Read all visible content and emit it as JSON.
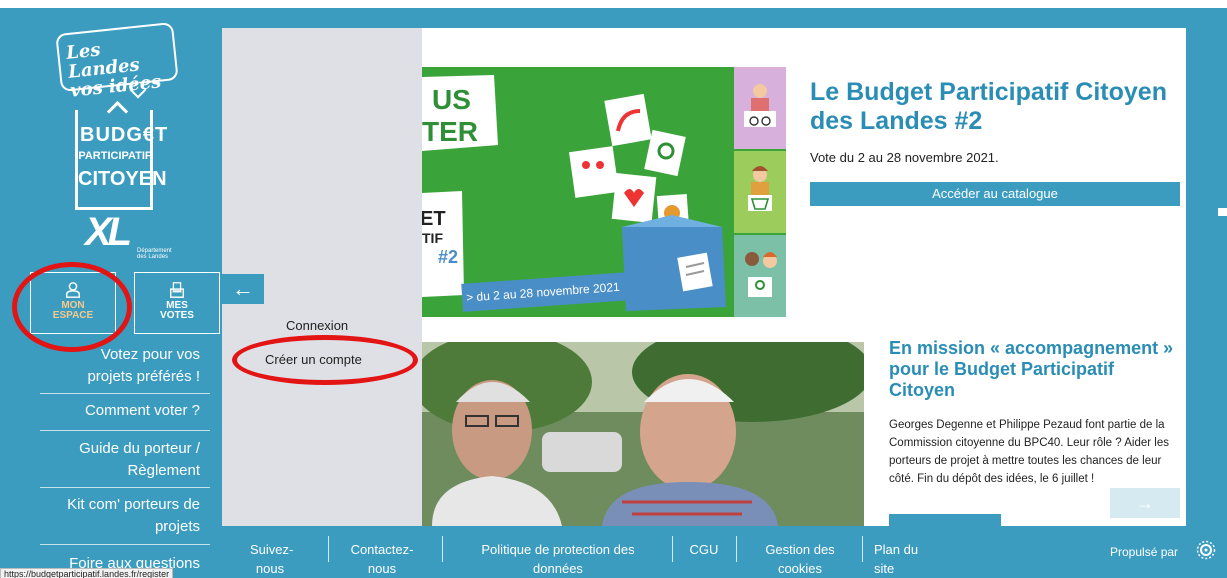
{
  "logo": {
    "line1": "Les Landes",
    "line2": "vos idées",
    "budget1": "BUDG€T",
    "budget2": "PARTICIPATIF",
    "budget3": "CITOYEN",
    "xl": "XL",
    "dept1": "Département",
    "dept2": "des Landes"
  },
  "account_buttons": {
    "espace_line1": "MON",
    "espace_line2": "ESPACE",
    "votes_line1": "MES",
    "votes_line2": "VOTES"
  },
  "sidebar_menu": [
    {
      "label_line1": "Votez pour vos",
      "label_line2": "projets préférés !"
    },
    {
      "label_line1": "Comment voter ?"
    },
    {
      "label_line1": "Guide du porteur /",
      "label_line2": "Règlement"
    },
    {
      "label_line1": "Kit com' porteurs de",
      "label_line2": "projets"
    },
    {
      "label_line1": "Foire aux questions"
    }
  ],
  "dropdown": {
    "back_symbol": "←",
    "connexion": "Connexion",
    "creer_compte": "Créer un compte"
  },
  "banner": {
    "text_a": "US",
    "text_b": "TER",
    "text_c": "ET",
    "text_d": "TIF",
    "text_e": "#2",
    "date": "> du 2 au 28 novembre 2021"
  },
  "feature1": {
    "title": "Le Budget Participatif Citoyen des Landes #2",
    "subtitle": "Vote du 2 au 28 novembre 2021.",
    "cta": "Accéder au catalogue"
  },
  "feature2": {
    "title": "En mission « accompagnement » pour le Budget Participatif Citoyen",
    "body": "Georges Degenne et Philippe Pezaud font partie de la Commission citoyenne du BPC40. Leur rôle ? Aider les porteurs de projet à mettre toutes les chances de leur côté. Fin du dépôt des idées, le 6 juillet !",
    "arrow": "→"
  },
  "footer": {
    "suivez": [
      "Suivez-",
      "nous"
    ],
    "contactez": [
      "Contactez-",
      "nous"
    ],
    "politique": [
      "Politique de protection des",
      "données"
    ],
    "cgu": "CGU",
    "cookies": [
      "Gestion des",
      "cookies"
    ],
    "plan": [
      "Plan du",
      "site"
    ],
    "propulse": "Propulsé par"
  },
  "status_url": "https://budgetparticipatif.landes.fr/register",
  "colors": {
    "brand_blue": "#3b9cc0",
    "title_blue": "#2a8db5",
    "panel_gray": "#dfdfe6",
    "annotation_red": "#e31414",
    "banner_green": "#3aa43a",
    "espace_text": "#f4c98e"
  }
}
